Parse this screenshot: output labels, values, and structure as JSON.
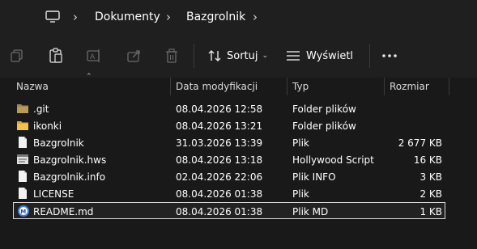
{
  "addressbar": {
    "breadcrumb": [
      "Dokumenty",
      "Bazgrolnik"
    ]
  },
  "toolbar": {
    "sort_label": "Sortuj",
    "view_label": "Wyświetl"
  },
  "columns": {
    "name": "Nazwa",
    "modified": "Data modyfikacji",
    "type": "Typ",
    "size": "Rozmiar"
  },
  "files": [
    {
      "name": ".git",
      "modified": "08.04.2026 12:58",
      "type": "Folder plików",
      "size": "",
      "icon": "folder-icon"
    },
    {
      "name": "ikonki",
      "modified": "08.04.2026 13:21",
      "type": "Folder plików",
      "size": "",
      "icon": "folder-icon"
    },
    {
      "name": "Bazgrolnik",
      "modified": "31.03.2026 13:39",
      "type": "Plik",
      "size": "2 677 KB",
      "icon": "file-icon"
    },
    {
      "name": "Bazgrolnik.hws",
      "modified": "08.04.2026 13:18",
      "type": "Hollywood Script",
      "size": "16 KB",
      "icon": "script-file-icon"
    },
    {
      "name": "Bazgrolnik.info",
      "modified": "02.04.2026 22:06",
      "type": "Plik INFO",
      "size": "3 KB",
      "icon": "file-icon"
    },
    {
      "name": "LICENSE",
      "modified": "08.04.2026 01:38",
      "type": "Plik",
      "size": "2 KB",
      "icon": "file-icon"
    },
    {
      "name": "README.md",
      "modified": "08.04.2026 01:38",
      "type": "Plik MD",
      "size": "1 KB",
      "icon": "markdown-file-icon",
      "selected": true
    }
  ],
  "colors": {
    "background": "#191919",
    "bar": "#1f1f1f",
    "folder": "#e8b74a",
    "folder_dark": "#a08550"
  }
}
